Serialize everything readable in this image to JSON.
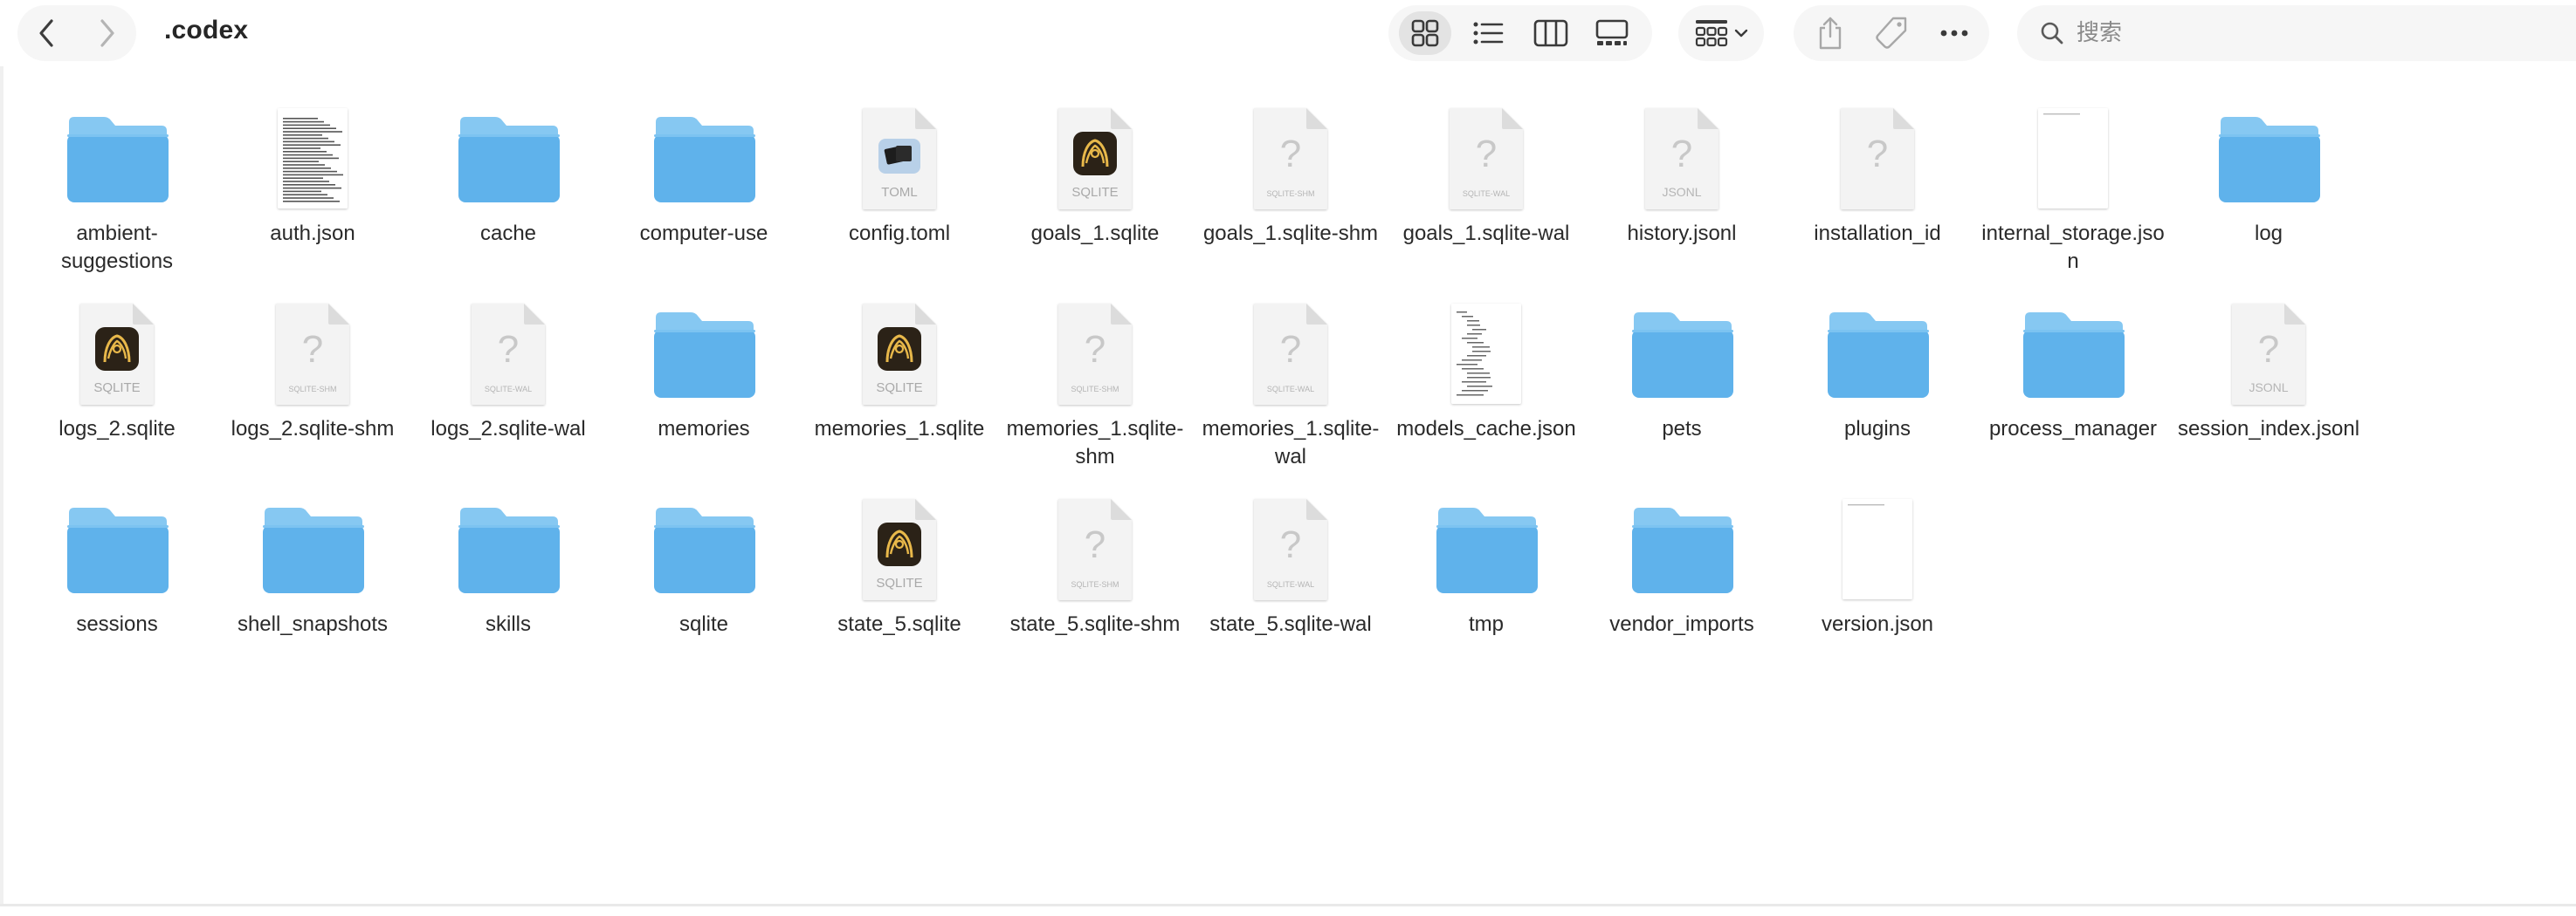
{
  "window": {
    "title": ".codex"
  },
  "search": {
    "placeholder": "搜索"
  },
  "colors": {
    "folder": "#5fb2eb",
    "folder_top": "#86c8f2",
    "toolbar_bg": "#f6f6f6",
    "sqlite_badge": "#2b2217"
  },
  "toolbar": {
    "icons": [
      "back-icon",
      "forward-icon",
      "icon-view-icon",
      "list-view-icon",
      "column-view-icon",
      "gallery-view-icon",
      "group-by-icon",
      "share-icon",
      "tag-icon",
      "more-icon",
      "search-icon"
    ]
  },
  "files": [
    {
      "name": "ambient-suggestions",
      "kind": "folder"
    },
    {
      "name": "auth.json",
      "kind": "textdoc"
    },
    {
      "name": "cache",
      "kind": "folder"
    },
    {
      "name": "computer-use",
      "kind": "folder"
    },
    {
      "name": "config.toml",
      "kind": "toml",
      "badge": "TOML"
    },
    {
      "name": "goals_1.sqlite",
      "kind": "sqlite",
      "badge": "SQLITE"
    },
    {
      "name": "goals_1.sqlite-shm",
      "kind": "generic",
      "badge": "SQLITE-SHM"
    },
    {
      "name": "goals_1.sqlite-wal",
      "kind": "generic",
      "badge": "SQLITE-WAL"
    },
    {
      "name": "history.jsonl",
      "kind": "generic",
      "badge": "JSONL"
    },
    {
      "name": "installation_id",
      "kind": "generic",
      "badge": ""
    },
    {
      "name": "internal_storage.json",
      "kind": "blankdoc"
    },
    {
      "name": "log",
      "kind": "folder"
    },
    {
      "name": "logs_2.sqlite",
      "kind": "sqlite",
      "badge": "SQLITE"
    },
    {
      "name": "logs_2.sqlite-shm",
      "kind": "generic",
      "badge": "SQLITE-SHM"
    },
    {
      "name": "logs_2.sqlite-wal",
      "kind": "generic",
      "badge": "SQLITE-WAL"
    },
    {
      "name": "memories",
      "kind": "folder"
    },
    {
      "name": "memories_1.sqlite",
      "kind": "sqlite",
      "badge": "SQLITE"
    },
    {
      "name": "memories_1.sqlite-shm",
      "kind": "generic",
      "badge": "SQLITE-SHM"
    },
    {
      "name": "memories_1.sqlite-wal",
      "kind": "generic",
      "badge": "SQLITE-WAL"
    },
    {
      "name": "models_cache.json",
      "kind": "codedoc"
    },
    {
      "name": "pets",
      "kind": "folder"
    },
    {
      "name": "plugins",
      "kind": "folder"
    },
    {
      "name": "process_manager",
      "kind": "folder"
    },
    {
      "name": "session_index.jsonl",
      "kind": "generic",
      "badge": "JSONL"
    },
    {
      "name": "sessions",
      "kind": "folder"
    },
    {
      "name": "shell_snapshots",
      "kind": "folder"
    },
    {
      "name": "skills",
      "kind": "folder"
    },
    {
      "name": "sqlite",
      "kind": "folder"
    },
    {
      "name": "state_5.sqlite",
      "kind": "sqlite",
      "badge": "SQLITE"
    },
    {
      "name": "state_5.sqlite-shm",
      "kind": "generic",
      "badge": "SQLITE-SHM"
    },
    {
      "name": "state_5.sqlite-wal",
      "kind": "generic",
      "badge": "SQLITE-WAL"
    },
    {
      "name": "tmp",
      "kind": "folder"
    },
    {
      "name": "vendor_imports",
      "kind": "folder"
    },
    {
      "name": "version.json",
      "kind": "blankdoc"
    }
  ]
}
